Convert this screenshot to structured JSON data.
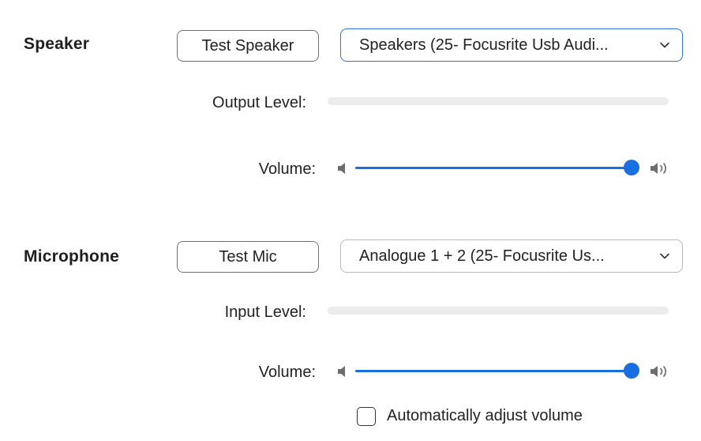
{
  "speaker": {
    "title": "Speaker",
    "test_button_label": "Test Speaker",
    "device_selected": "Speakers (25- Focusrite Usb Audi...",
    "output_level_label": "Output Level:",
    "output_level_fraction": 0,
    "volume_label": "Volume:",
    "volume_fraction": 1.0,
    "volume_low_icon": "volume-low-icon",
    "volume_high_icon": "volume-high-icon"
  },
  "microphone": {
    "title": "Microphone",
    "test_button_label": "Test Mic",
    "device_selected": "Analogue 1 + 2 (25- Focusrite Us...",
    "input_level_label": "Input Level:",
    "input_level_fraction": 0,
    "volume_label": "Volume:",
    "volume_fraction": 1.0,
    "volume_low_icon": "volume-low-icon",
    "volume_high_icon": "volume-high-icon",
    "auto_adjust_label": "Automatically adjust volume",
    "auto_adjust_checked": false
  },
  "colors": {
    "accent": "#1a6fe0",
    "focus_border": "#2d74d8",
    "meter_track": "#ececec",
    "icon_gray": "#6d6d6d"
  }
}
